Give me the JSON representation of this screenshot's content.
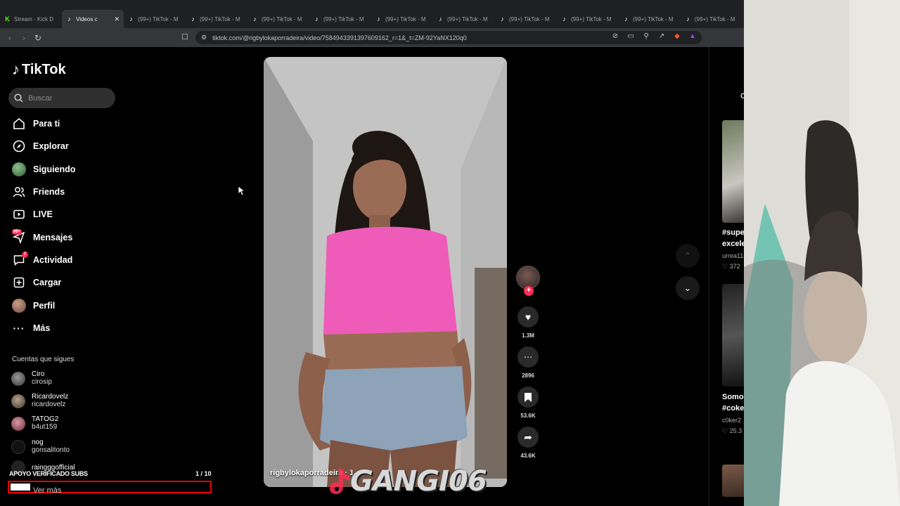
{
  "browser": {
    "tabs": [
      {
        "label": "Stream - Kick D",
        "favicon": "kick-icon",
        "active": false
      },
      {
        "label": "Videos c",
        "favicon": "tiktok-icon",
        "active": true
      },
      {
        "label": "(99+) TikTok - M",
        "favicon": "tiktok-icon",
        "active": false
      },
      {
        "label": "(99+) TikTok - M",
        "favicon": "tiktok-icon",
        "active": false
      },
      {
        "label": "(99+) TikTok - M",
        "favicon": "tiktok-icon",
        "active": false
      },
      {
        "label": "(99+) TikTok - M",
        "favicon": "tiktok-icon",
        "active": false
      },
      {
        "label": "(99+) TikTok - M",
        "favicon": "tiktok-icon",
        "active": false
      },
      {
        "label": "(99+) TikTok - M",
        "favicon": "tiktok-icon",
        "active": false
      },
      {
        "label": "(99+) TikTok - M",
        "favicon": "tiktok-icon",
        "active": false
      },
      {
        "label": "(99+) TikTok - M",
        "favicon": "tiktok-icon",
        "active": false
      },
      {
        "label": "(99+) TikTok - M",
        "favicon": "tiktok-icon",
        "active": false
      },
      {
        "label": "(99+) TikTok - M",
        "favicon": "tiktok-icon",
        "active": false
      }
    ],
    "url": "tiktok.com/@rigbylokaporradeira/video/7584943391397609162_r=1&_t=ZM-92YaNX120q0"
  },
  "tiktok": {
    "logo_text": "TikTok",
    "search_placeholder": "Buscar",
    "nav": [
      {
        "label": "Para ti",
        "icon": "home-icon"
      },
      {
        "label": "Explorar",
        "icon": "compass-icon"
      },
      {
        "label": "Siguiendo",
        "icon": "following-avatar-icon"
      },
      {
        "label": "Friends",
        "icon": "friends-icon"
      },
      {
        "label": "LIVE",
        "icon": "live-icon"
      },
      {
        "label": "Mensajes",
        "icon": "messages-icon",
        "badge": "99+"
      },
      {
        "label": "Actividad",
        "icon": "activity-icon",
        "badge": "7"
      },
      {
        "label": "Cargar",
        "icon": "upload-icon"
      },
      {
        "label": "Perfil",
        "icon": "profile-avatar-icon"
      },
      {
        "label": "Más",
        "icon": "more-icon"
      }
    ],
    "following_title": "Cuentas que sigues",
    "following": [
      {
        "name": "Ciro",
        "user": "cirosip"
      },
      {
        "name": "Ricardovelz",
        "user": "ricardovelz"
      },
      {
        "name": "TATOG2",
        "user": "b4ut159"
      },
      {
        "name": "nog",
        "user": "gonsalitonto"
      },
      {
        "name": "raingggofficial",
        "user": ""
      }
    ],
    "see_more": "Ver más",
    "video": {
      "author": "rigbylokaporradeira · 1",
      "likes": "1.3M",
      "comments": "2896",
      "saves": "53.6K",
      "shares": "43.6K"
    },
    "right_column": {
      "header_letter": "C",
      "items": [
        {
          "title_1": "#supe",
          "title_2": "excele",
          "user": "urrea11",
          "likes": "372"
        },
        {
          "title_1": "Somos",
          "title_2": "#coke",
          "user": "c0ker2",
          "likes": "25.3"
        }
      ]
    }
  },
  "stream_overlay": {
    "goal_label": "APOYO VERIFICADO SUBS",
    "goal_count": "1 / 10",
    "goal_progress": 0.1,
    "brand": "GANGI06"
  },
  "colors": {
    "accent": "#fe2c55",
    "goal_border": "#ee0000",
    "kick_green": "#53fc18"
  }
}
